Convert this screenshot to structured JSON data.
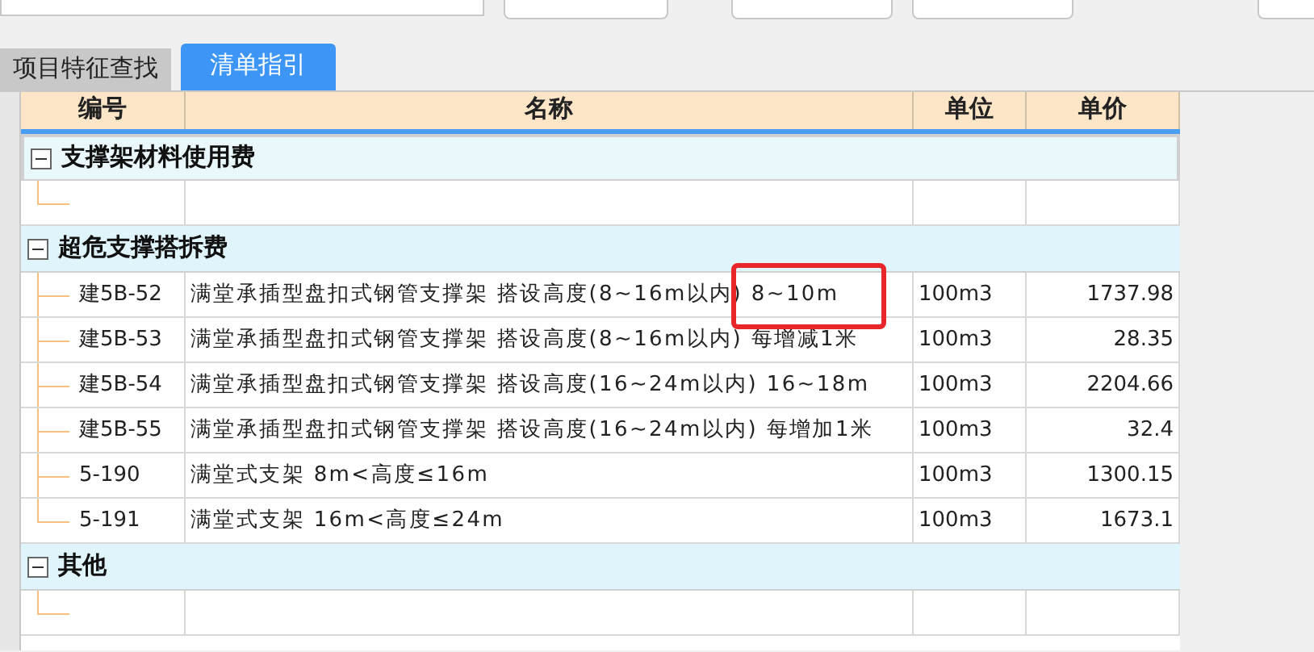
{
  "tabs": [
    {
      "label": "项目特征查找",
      "selected": false
    },
    {
      "label": "清单指引",
      "selected": true
    }
  ],
  "table": {
    "columns": [
      "编号",
      "名称",
      "单位",
      "单价"
    ],
    "groups": [
      {
        "name": "支撑架材料使用费",
        "expanded": true,
        "selected": true,
        "children": [
          {
            "kind": "blank"
          }
        ]
      },
      {
        "name": "超危支撑搭拆费",
        "expanded": true,
        "selected": false,
        "children": [
          {
            "kind": "item",
            "code": "建5B-52",
            "name": "满堂承插型盘扣式钢管支撑架 搭设高度(8~16m以内) 8~10m",
            "unit": "100m3",
            "price": "1737.98"
          },
          {
            "kind": "item",
            "code": "建5B-53",
            "name": "满堂承插型盘扣式钢管支撑架 搭设高度(8~16m以内) 每增减1米",
            "unit": "100m3",
            "price": "28.35"
          },
          {
            "kind": "item",
            "code": "建5B-54",
            "name": "满堂承插型盘扣式钢管支撑架 搭设高度(16~24m以内) 16~18m",
            "unit": "100m3",
            "price": "2204.66"
          },
          {
            "kind": "item",
            "code": "建5B-55",
            "name": "满堂承插型盘扣式钢管支撑架 搭设高度(16~24m以内) 每增加1米",
            "unit": "100m3",
            "price": "32.4"
          },
          {
            "kind": "item",
            "code": "5-190",
            "name": "满堂式支架 8m<高度≤16m",
            "unit": "100m3",
            "price": "1300.15"
          },
          {
            "kind": "item",
            "code": "5-191",
            "name": "满堂式支架 16m<高度≤24m",
            "unit": "100m3",
            "price": "1673.1"
          }
        ]
      },
      {
        "name": "其他",
        "expanded": true,
        "selected": false,
        "children": [
          {
            "kind": "blank"
          }
        ]
      }
    ]
  }
}
